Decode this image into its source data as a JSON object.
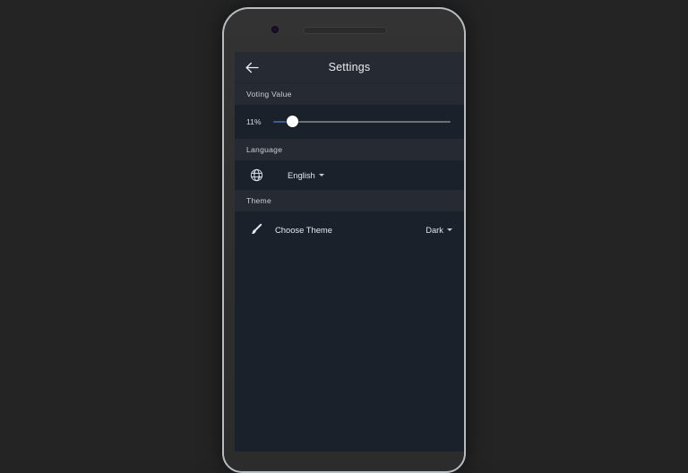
{
  "app": {
    "header": {
      "title": "Settings",
      "back_icon": "arrow-left-icon"
    }
  },
  "sections": {
    "voting": {
      "header": "Voting Value",
      "slider": {
        "value_label": "11%",
        "percent": 11,
        "min": 0,
        "max": 100,
        "fill_color": "#3d5d8e",
        "track_color": "#6d7074",
        "thumb_color": "#ffffff"
      }
    },
    "language": {
      "header": "Language",
      "icon": "globe-icon",
      "selected": "English",
      "caret_icon": "chevron-down-icon"
    },
    "theme": {
      "header": "Theme",
      "icon": "paintbrush-icon",
      "label": "Choose Theme",
      "selected": "Dark",
      "caret_icon": "chevron-down-icon"
    }
  },
  "device": {
    "camera_icon": "camera-dot",
    "speaker_icon": "earpiece-speaker"
  },
  "colors": {
    "page_background": "#242424",
    "screen_background": "#1b212b",
    "appbar_background": "#262b33",
    "section_strip": "#262b33",
    "primary_text": "#e6e9ed",
    "secondary_text": "#c9ced6",
    "bezel": "#b9bcbe"
  }
}
